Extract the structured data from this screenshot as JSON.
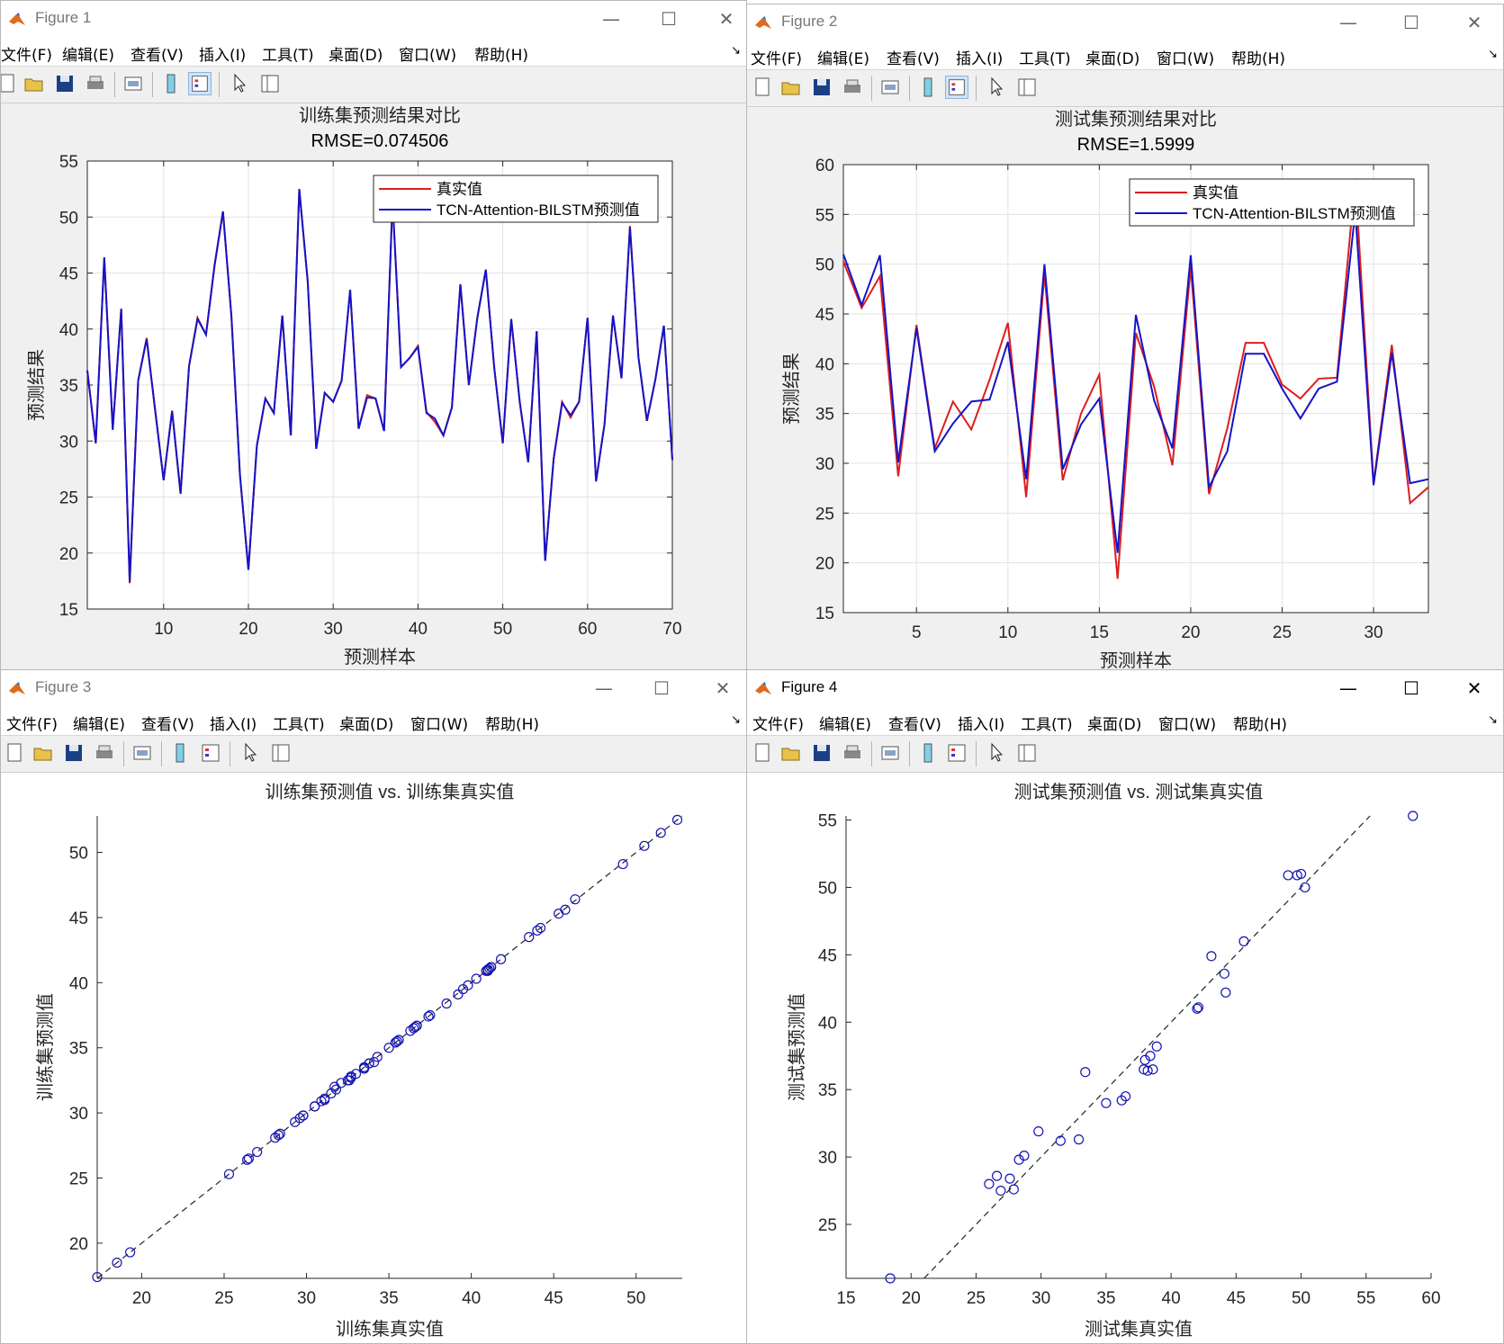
{
  "menu_labels": [
    "文件(F)",
    "编辑(E)",
    "查看(V)",
    "插入(I)",
    "工具(T)",
    "桌面(D)",
    "窗口(W)",
    "帮助(H)"
  ],
  "window_controls": {
    "minimize": "—",
    "maximize": "☐",
    "close": "✕"
  },
  "toolbar_icons": [
    "new-file-icon",
    "open-folder-icon",
    "save-icon",
    "print-icon",
    "print-figure-icon",
    "colorbar-icon",
    "legend-icon",
    "pointer-icon",
    "property-inspector-icon"
  ],
  "colors": {
    "true": "#dc1e1e",
    "pred": "#1414c8",
    "scatter": "#1414b4"
  },
  "windows": [
    {
      "title": "Figure 1"
    },
    {
      "title": "Figure 2"
    },
    {
      "title": "Figure 3"
    },
    {
      "title": "Figure 4"
    }
  ],
  "chart_data": [
    {
      "type": "line",
      "title": "训练集预测结果对比",
      "subtitle": "RMSE=0.074506",
      "xlabel": "预测样本",
      "ylabel": "预测结果",
      "xlim": [
        1,
        70
      ],
      "ylim": [
        15,
        55
      ],
      "xticks": [
        10,
        20,
        30,
        40,
        50,
        60,
        70
      ],
      "yticks": [
        15,
        20,
        25,
        30,
        35,
        40,
        45,
        50,
        55
      ],
      "grid": true,
      "legend_position": "top-right",
      "x": [
        1,
        2,
        3,
        4,
        5,
        6,
        7,
        8,
        9,
        10,
        11,
        12,
        13,
        14,
        15,
        16,
        17,
        18,
        19,
        20,
        21,
        22,
        23,
        24,
        25,
        26,
        27,
        28,
        29,
        30,
        31,
        32,
        33,
        34,
        35,
        36,
        37,
        38,
        39,
        40,
        41,
        42,
        43,
        44,
        45,
        46,
        47,
        48,
        49,
        50,
        51,
        52,
        53,
        54,
        55,
        56,
        57,
        58,
        59,
        60,
        61,
        62,
        63,
        64,
        65,
        66,
        67,
        68,
        69,
        70
      ],
      "series": [
        {
          "name": "真实值",
          "color": "#dc1e1e",
          "values": [
            36.3,
            29.8,
            46.3,
            31.1,
            41.8,
            17.3,
            35.4,
            39.2,
            32.7,
            26.5,
            32.7,
            25.3,
            36.7,
            41.0,
            39.5,
            45.7,
            50.5,
            41.1,
            27.0,
            18.5,
            29.6,
            33.8,
            32.5,
            41.2,
            30.5,
            52.5,
            44.2,
            29.3,
            34.3,
            33.5,
            35.4,
            43.5,
            31.1,
            34.1,
            33.8,
            30.9,
            51.5,
            36.6,
            37.4,
            38.5,
            32.6,
            31.7,
            30.5,
            33.0,
            44.0,
            35.0,
            41.0,
            45.3,
            36.5,
            29.8,
            40.9,
            33.5,
            28.1,
            39.8,
            19.3,
            28.4,
            33.5,
            32.1,
            33.5,
            41.0,
            26.4,
            31.5,
            41.2,
            35.6,
            49.2,
            37.5,
            31.8,
            35.5,
            40.3,
            28.3
          ]
        },
        {
          "name": "TCN-Attention-BILSTM预测值",
          "color": "#1414c8",
          "values": [
            36.3,
            29.8,
            46.4,
            31.0,
            41.8,
            17.4,
            35.4,
            39.1,
            32.8,
            26.5,
            32.7,
            25.3,
            36.7,
            40.9,
            39.5,
            45.6,
            50.5,
            41.1,
            27.0,
            18.5,
            29.6,
            33.8,
            32.5,
            41.2,
            30.5,
            52.5,
            44.2,
            29.3,
            34.3,
            33.5,
            35.4,
            43.5,
            31.1,
            33.9,
            33.8,
            30.9,
            51.5,
            36.6,
            37.4,
            38.4,
            32.5,
            32.0,
            30.5,
            33.0,
            44.0,
            35.0,
            41.0,
            45.3,
            36.5,
            29.8,
            40.9,
            33.5,
            28.1,
            39.8,
            19.3,
            28.4,
            33.4,
            32.3,
            33.5,
            41.0,
            26.4,
            31.5,
            41.2,
            35.6,
            49.1,
            37.5,
            31.8,
            35.5,
            40.3,
            28.3
          ]
        }
      ]
    },
    {
      "type": "line",
      "title": "测试集预测结果对比",
      "subtitle": "RMSE=1.5999",
      "xlabel": "预测样本",
      "ylabel": "预测结果",
      "xlim": [
        1,
        33
      ],
      "ylim": [
        15,
        60
      ],
      "xticks": [
        5,
        10,
        15,
        20,
        25,
        30
      ],
      "yticks": [
        15,
        20,
        25,
        30,
        35,
        40,
        45,
        50,
        55,
        60
      ],
      "grid": true,
      "legend_position": "top-right",
      "x": [
        1,
        2,
        3,
        4,
        5,
        6,
        7,
        8,
        9,
        10,
        11,
        12,
        13,
        14,
        15,
        16,
        17,
        18,
        19,
        20,
        21,
        22,
        23,
        24,
        25,
        26,
        27,
        28,
        29,
        30,
        31,
        32,
        33
      ],
      "series": [
        {
          "name": "真实值",
          "color": "#dc1e1e",
          "values": [
            50.3,
            45.6,
            48.8,
            28.7,
            43.9,
            31.5,
            36.2,
            33.4,
            38.4,
            44.1,
            26.6,
            49.0,
            28.3,
            35.0,
            38.9,
            18.4,
            43.1,
            37.7,
            29.8,
            49.7,
            26.9,
            33.5,
            42.1,
            42.1,
            37.9,
            36.5,
            38.5,
            38.6,
            58.6,
            28.0,
            41.9,
            26.0,
            27.6
          ]
        },
        {
          "name": "TCN-Attention-BILSTM预测值",
          "color": "#1414c8",
          "values": [
            51.0,
            45.9,
            50.9,
            30.1,
            43.6,
            31.2,
            34.0,
            36.2,
            36.4,
            42.2,
            28.4,
            50.0,
            29.4,
            33.9,
            36.5,
            21.0,
            44.9,
            36.3,
            31.5,
            50.9,
            27.6,
            31.2,
            41.0,
            41.0,
            37.5,
            34.5,
            37.5,
            38.2,
            55.3,
            27.8,
            41.1,
            28.0,
            28.4
          ]
        }
      ]
    },
    {
      "type": "scatter",
      "title": "训练集预测值 vs. 训练集真实值",
      "xlabel": "训练集真实值",
      "ylabel": "训练集预测值",
      "xlim": [
        17.3,
        52.8
      ],
      "ylim": [
        17.3,
        52.8
      ],
      "xticks": [
        20,
        25,
        30,
        35,
        40,
        45,
        50
      ],
      "yticks": [
        20,
        25,
        30,
        35,
        40,
        45,
        50
      ],
      "grid": false,
      "reference_line": "y=x",
      "series": [
        {
          "name": "",
          "color": "#1414b4",
          "x": [
            36.3,
            29.8,
            46.3,
            31.1,
            41.8,
            17.3,
            35.4,
            39.2,
            32.7,
            26.5,
            32.7,
            25.3,
            36.7,
            41.0,
            39.5,
            45.7,
            50.5,
            41.1,
            27.0,
            18.5,
            29.6,
            33.8,
            32.5,
            41.2,
            30.5,
            52.5,
            44.2,
            29.3,
            34.3,
            33.5,
            35.4,
            43.5,
            31.1,
            34.1,
            33.8,
            30.9,
            51.5,
            36.6,
            37.4,
            38.5,
            32.6,
            31.7,
            30.5,
            33.0,
            44.0,
            35.0,
            41.0,
            45.3,
            36.5,
            29.8,
            40.9,
            33.5,
            28.1,
            39.8,
            19.3,
            28.4,
            33.5,
            32.1,
            33.5,
            41.0,
            26.4,
            31.5,
            41.2,
            35.6,
            49.2,
            37.5,
            31.8,
            35.5,
            40.3,
            28.3
          ],
          "y": [
            36.3,
            29.8,
            46.4,
            31.0,
            41.8,
            17.4,
            35.4,
            39.1,
            32.8,
            26.5,
            32.7,
            25.3,
            36.7,
            40.9,
            39.5,
            45.6,
            50.5,
            41.1,
            27.0,
            18.5,
            29.6,
            33.8,
            32.5,
            41.2,
            30.5,
            52.5,
            44.2,
            29.3,
            34.3,
            33.5,
            35.4,
            43.5,
            31.1,
            33.9,
            33.8,
            30.9,
            51.5,
            36.6,
            37.4,
            38.4,
            32.5,
            32.0,
            30.5,
            33.0,
            44.0,
            35.0,
            41.0,
            45.3,
            36.5,
            29.8,
            40.9,
            33.5,
            28.1,
            39.8,
            19.3,
            28.4,
            33.4,
            32.3,
            33.5,
            41.0,
            26.4,
            31.5,
            41.2,
            35.6,
            49.1,
            37.5,
            31.8,
            35.5,
            40.3,
            28.3
          ]
        }
      ]
    },
    {
      "type": "scatter",
      "title": "测试集预测值 vs. 测试集真实值",
      "xlabel": "测试集真实值",
      "ylabel": "测试集预测值",
      "xlim": [
        15,
        60
      ],
      "ylim": [
        21,
        55.3
      ],
      "xticks": [
        15,
        20,
        25,
        30,
        35,
        40,
        45,
        50,
        55,
        60
      ],
      "yticks": [
        25,
        30,
        35,
        40,
        45,
        50,
        55
      ],
      "grid": false,
      "reference_line": "y=x",
      "series": [
        {
          "name": "",
          "color": "#1414b4",
          "x": [
            58.6,
            49.0,
            49.7,
            50.0,
            50.3,
            45.6,
            43.1,
            44.1,
            44.2,
            42.1,
            42.0,
            38.9,
            38.4,
            38.6,
            38.0,
            37.9,
            38.2,
            36.5,
            36.2,
            33.4,
            35.0,
            32.9,
            31.5,
            29.8,
            28.7,
            28.3,
            26.0,
            26.6,
            27.6,
            27.9,
            26.9,
            18.4
          ],
          "y": [
            55.3,
            50.9,
            50.9,
            51.0,
            50.0,
            46.0,
            44.9,
            43.6,
            42.2,
            41.1,
            41.0,
            38.2,
            37.5,
            36.5,
            37.2,
            36.5,
            36.4,
            34.5,
            34.2,
            36.3,
            34.0,
            31.3,
            31.2,
            31.9,
            30.1,
            29.8,
            28.0,
            28.6,
            28.4,
            27.6,
            27.5,
            21.0
          ]
        }
      ]
    }
  ]
}
